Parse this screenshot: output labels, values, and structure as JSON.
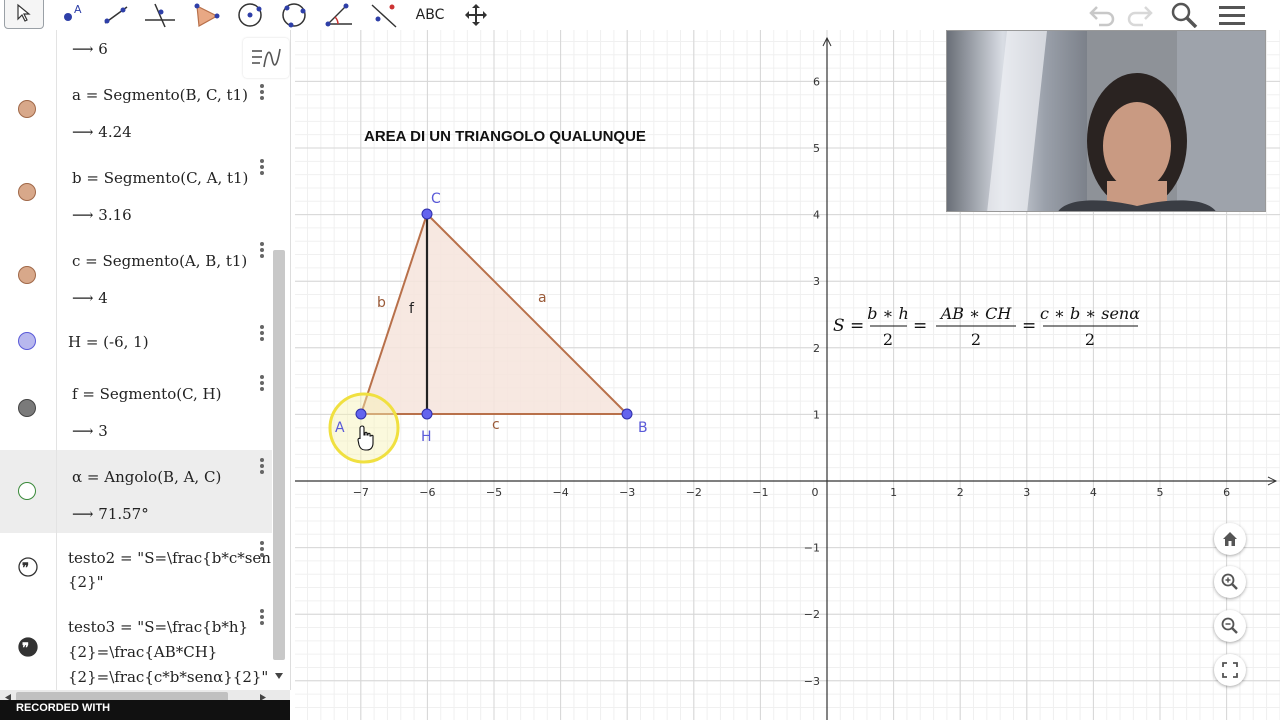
{
  "toolbar": {
    "text_tool_label": "ABC",
    "tools": [
      "move-tool",
      "point-tool",
      "line-tool",
      "perpendicular-tool",
      "polygon-tool",
      "circle-tool",
      "circle-three-points-tool",
      "angle-tool",
      "reflect-tool",
      "text-tool",
      "move-graphics-tool"
    ]
  },
  "algebra": {
    "row0": {
      "value": "⟶  6"
    },
    "rows": [
      {
        "def": "a = Segmento(B, C, t1)",
        "value": "⟶  4.24",
        "color": "#d8a88a"
      },
      {
        "def": "b = Segmento(C, A, t1)",
        "value": "⟶  3.16",
        "color": "#d8a88a"
      },
      {
        "def": "c = Segmento(A, B, t1)",
        "value": "⟶  4",
        "color": "#d8a88a"
      },
      {
        "def": "H = (-6, 1)",
        "color": "#b8b8ee"
      },
      {
        "def": "f = Segmento(C, H)",
        "value": "⟶  3",
        "color": "#7a7a7a"
      },
      {
        "def": "α = Angolo(B, A, C)",
        "value": "⟶  71.57°",
        "color": "#ffffff"
      }
    ],
    "testo2": {
      "line1": "testo2 = \"S=\\frac{b*c*sen",
      "line2": "{2}\""
    },
    "testo3": {
      "line1": "testo3 = \"S=\\frac{b*h}",
      "line2": "{2}=\\frac{AB*CH}",
      "line3": "{2}=\\frac{c*b*senα}{2}\""
    }
  },
  "recorded": "RECORDED WITH",
  "graphics": {
    "title": "AREA DI UN TRIANGOLO QUALUNQUE",
    "x_ticks": [
      "−7",
      "−6",
      "−5",
      "−4",
      "−3",
      "−2",
      "−1",
      "0",
      "1",
      "2",
      "3",
      "4",
      "5",
      "6"
    ],
    "y_ticks": [
      "6",
      "5",
      "4",
      "3",
      "2",
      "1",
      "−1",
      "−2",
      "−3"
    ],
    "points": {
      "A": "A",
      "B": "B",
      "C": "C",
      "H": "H"
    },
    "segment_labels": {
      "a": "a",
      "b": "b",
      "c": "c",
      "f": "f"
    },
    "formula": {
      "S": "S =",
      "f1_num": "b ∗ h",
      "f1_den": "2",
      "f2_num": "AB ∗ CH",
      "f2_den": "2",
      "f3_num": "c ∗ b ∗ senα",
      "f3_den": "2",
      "eq": "="
    },
    "colors": {
      "triangle_fill": "#f6e4dc",
      "triangle_stroke": "#b8704a",
      "point": "#6464ee",
      "highlight": "#f0e040"
    }
  }
}
